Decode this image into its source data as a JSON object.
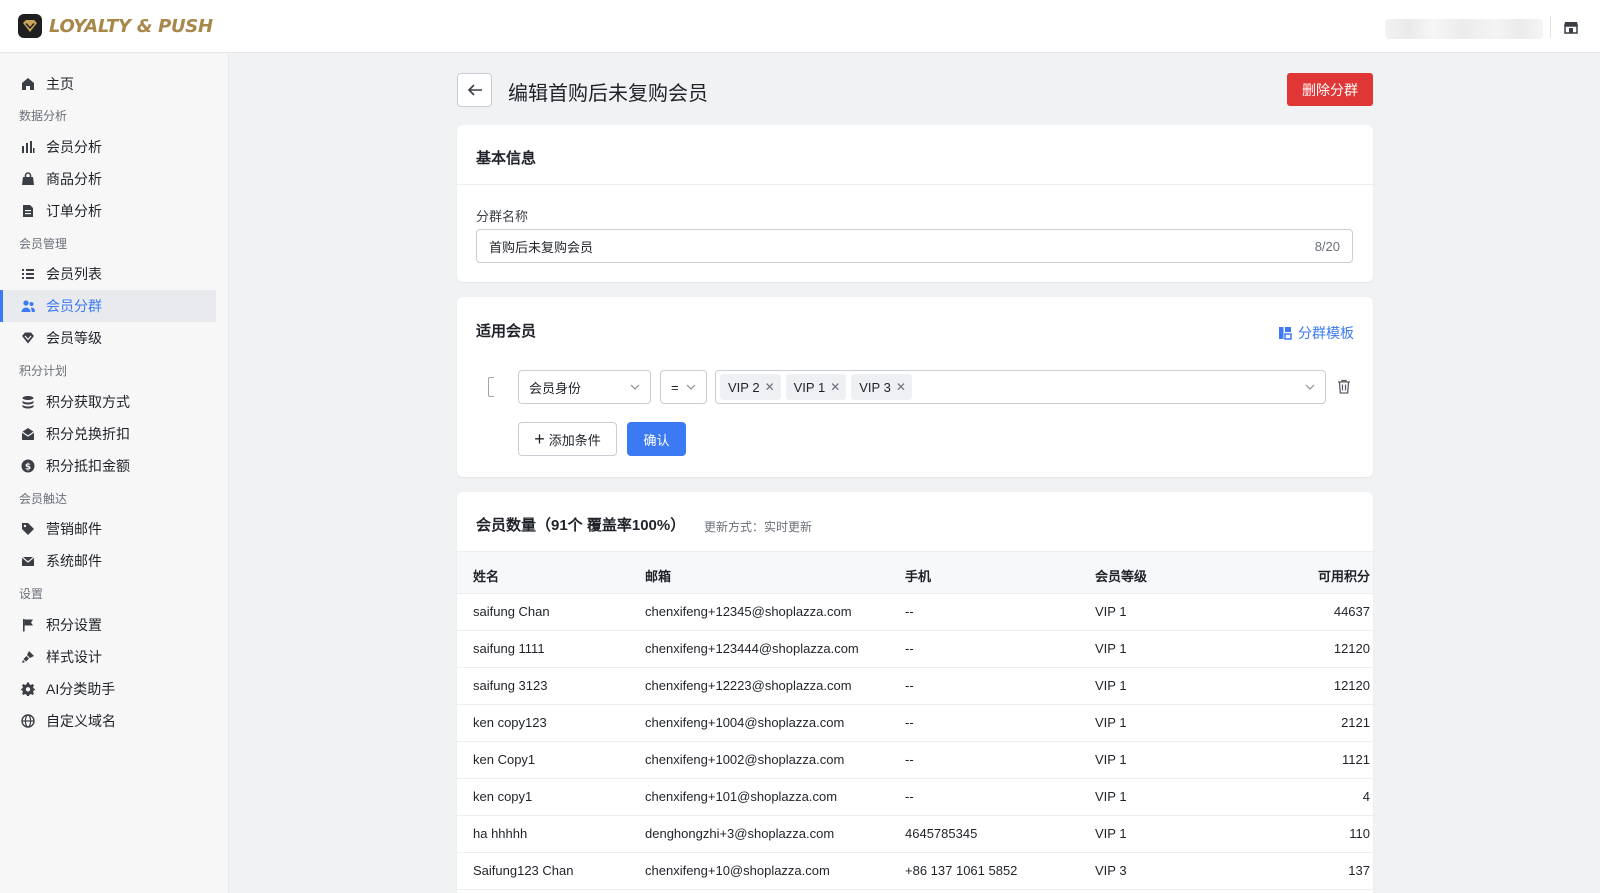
{
  "app": {
    "name": "LOYALTY & PUSH"
  },
  "sidebar": {
    "home": "主页",
    "groups": {
      "analytics": "数据分析",
      "members": "会员管理",
      "points": "积分计划",
      "reach": "会员触达",
      "settings": "设置"
    },
    "items": {
      "member_analysis": "会员分析",
      "product_analysis": "商品分析",
      "order_analysis": "订单分析",
      "member_list": "会员列表",
      "member_segments": "会员分群",
      "member_levels": "会员等级",
      "earn_points": "积分获取方式",
      "redeem_discount": "积分兑换折扣",
      "points_deduction": "积分抵扣金额",
      "marketing_email": "营销邮件",
      "system_email": "系统邮件",
      "points_settings": "积分设置",
      "style_design": "样式设计",
      "ai_assistant": "AI分类助手",
      "custom_domain": "自定义域名"
    },
    "active": "member_segments"
  },
  "page": {
    "title": "编辑首购后未复购会员",
    "delete_label": "删除分群"
  },
  "basic_info": {
    "title": "基本信息",
    "name_label": "分群名称",
    "name_value": "首购后未复购会员",
    "name_counter": "8/20"
  },
  "applicable": {
    "title": "适用会员",
    "template_link": "分群模板",
    "condition": {
      "field": "会员身份",
      "operator": "=",
      "values": [
        "VIP 2",
        "VIP 1",
        "VIP 3"
      ]
    },
    "add_label": "添加条件",
    "confirm_label": "确认"
  },
  "members": {
    "title": "会员数量（91个 覆盖率100%）",
    "update_info": "更新方式：实时更新",
    "columns": [
      "姓名",
      "邮箱",
      "手机",
      "会员等级",
      "可用积分"
    ],
    "rows": [
      [
        "saifung Chan",
        "chenxifeng+12345@shoplazza.com",
        "--",
        "VIP 1",
        "44637"
      ],
      [
        "saifung 1111",
        "chenxifeng+123444@shoplazza.com",
        "--",
        "VIP 1",
        "12120"
      ],
      [
        "saifung 3123",
        "chenxifeng+12223@shoplazza.com",
        "--",
        "VIP 1",
        "12120"
      ],
      [
        "ken copy123",
        "chenxifeng+1004@shoplazza.com",
        "--",
        "VIP 1",
        "2121"
      ],
      [
        "ken Copy1",
        "chenxifeng+1002@shoplazza.com",
        "--",
        "VIP 1",
        "1121"
      ],
      [
        "ken copy1",
        "chenxifeng+101@shoplazza.com",
        "--",
        "VIP 1",
        "4"
      ],
      [
        "ha hhhhh",
        "denghongzhi+3@shoplazza.com",
        "4645785345",
        "VIP 1",
        "110"
      ],
      [
        "Saifung123 Chan",
        "chenxifeng+10@shoplazza.com",
        "+86 137 1061 5852",
        "VIP 3",
        "137"
      ]
    ]
  },
  "colors": {
    "accent": "#3c7af3",
    "danger": "#e03636",
    "brand_gold": "#a8874a"
  }
}
